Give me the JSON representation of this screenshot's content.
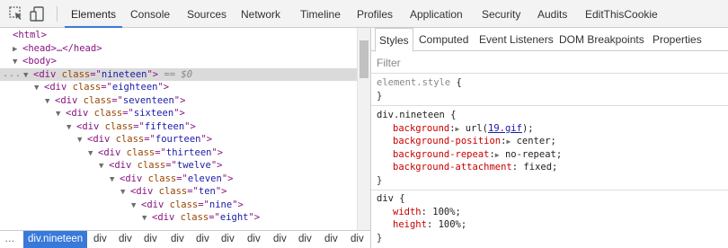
{
  "toolbar": {
    "inspect_icon": "inspect-cursor-icon",
    "device_icon": "device-mode-icon",
    "tabs": [
      "Elements",
      "Console",
      "Sources",
      "Network",
      "Timeline",
      "Profiles",
      "Application",
      "Security",
      "Audits",
      "EditThisCookie"
    ],
    "active_tab": "Elements"
  },
  "elements": {
    "lines": [
      {
        "text_open": "<",
        "tag": "html",
        "text_close": ">"
      },
      {
        "tag": "head",
        "ellipsis": "…</head>"
      },
      {
        "tag": "body"
      },
      {
        "tag": "div",
        "attr": "class",
        "value": "nineteen",
        "suffix": "== $0"
      },
      {
        "tag": "div",
        "attr": "class",
        "value": "eighteen"
      },
      {
        "tag": "div",
        "attr": "class",
        "value": "seventeen"
      },
      {
        "tag": "div",
        "attr": "class",
        "value": "sixteen"
      },
      {
        "tag": "div",
        "attr": "class",
        "value": "fifteen"
      },
      {
        "tag": "div",
        "attr": "class",
        "value": "fourteen"
      },
      {
        "tag": "div",
        "attr": "class",
        "value": "thirteen"
      },
      {
        "tag": "div",
        "attr": "class",
        "value": "twelve"
      },
      {
        "tag": "div",
        "attr": "class",
        "value": "eleven"
      },
      {
        "tag": "div",
        "attr": "class",
        "value": "ten"
      },
      {
        "tag": "div",
        "attr": "class",
        "value": "nine"
      },
      {
        "tag": "div",
        "attr": "class",
        "value": "eight"
      }
    ],
    "dots": "..."
  },
  "breadcrumbs": {
    "dots": "…",
    "active": "div.nineteen",
    "items": [
      "div",
      "div",
      "div",
      "div",
      "div",
      "div",
      "div",
      "div",
      "div",
      "div",
      "div"
    ]
  },
  "sidebar": {
    "tabs": [
      "Styles",
      "Computed",
      "Event Listeners",
      "DOM Breakpoints",
      "Properties"
    ],
    "active_tab": "Styles",
    "filter_placeholder": "Filter",
    "rules": [
      {
        "selector": "element.style",
        "open": " {",
        "close": "}",
        "declarations": []
      },
      {
        "selector": "div.nineteen",
        "open": " {",
        "close": "}",
        "declarations": [
          {
            "name": "background",
            "expandable": true,
            "value_pre": "url(",
            "link": "19.gif",
            "value_post": ");"
          },
          {
            "name": "background-position",
            "expandable": true,
            "value": "center;"
          },
          {
            "name": "background-repeat",
            "expandable": true,
            "value": "no-repeat;"
          },
          {
            "name": "background-attachment",
            "expandable": false,
            "value": "fixed;"
          }
        ]
      },
      {
        "selector": "div",
        "open": " {",
        "close": "}",
        "declarations": [
          {
            "name": "width",
            "value": "100%;"
          },
          {
            "name": "height",
            "value": "100%;"
          }
        ]
      }
    ]
  },
  "colors": {
    "accent": "#3879d9",
    "tag": "#881280",
    "attr_name": "#994500",
    "attr_value": "#1a1aa6",
    "css_property": "#c80000"
  }
}
